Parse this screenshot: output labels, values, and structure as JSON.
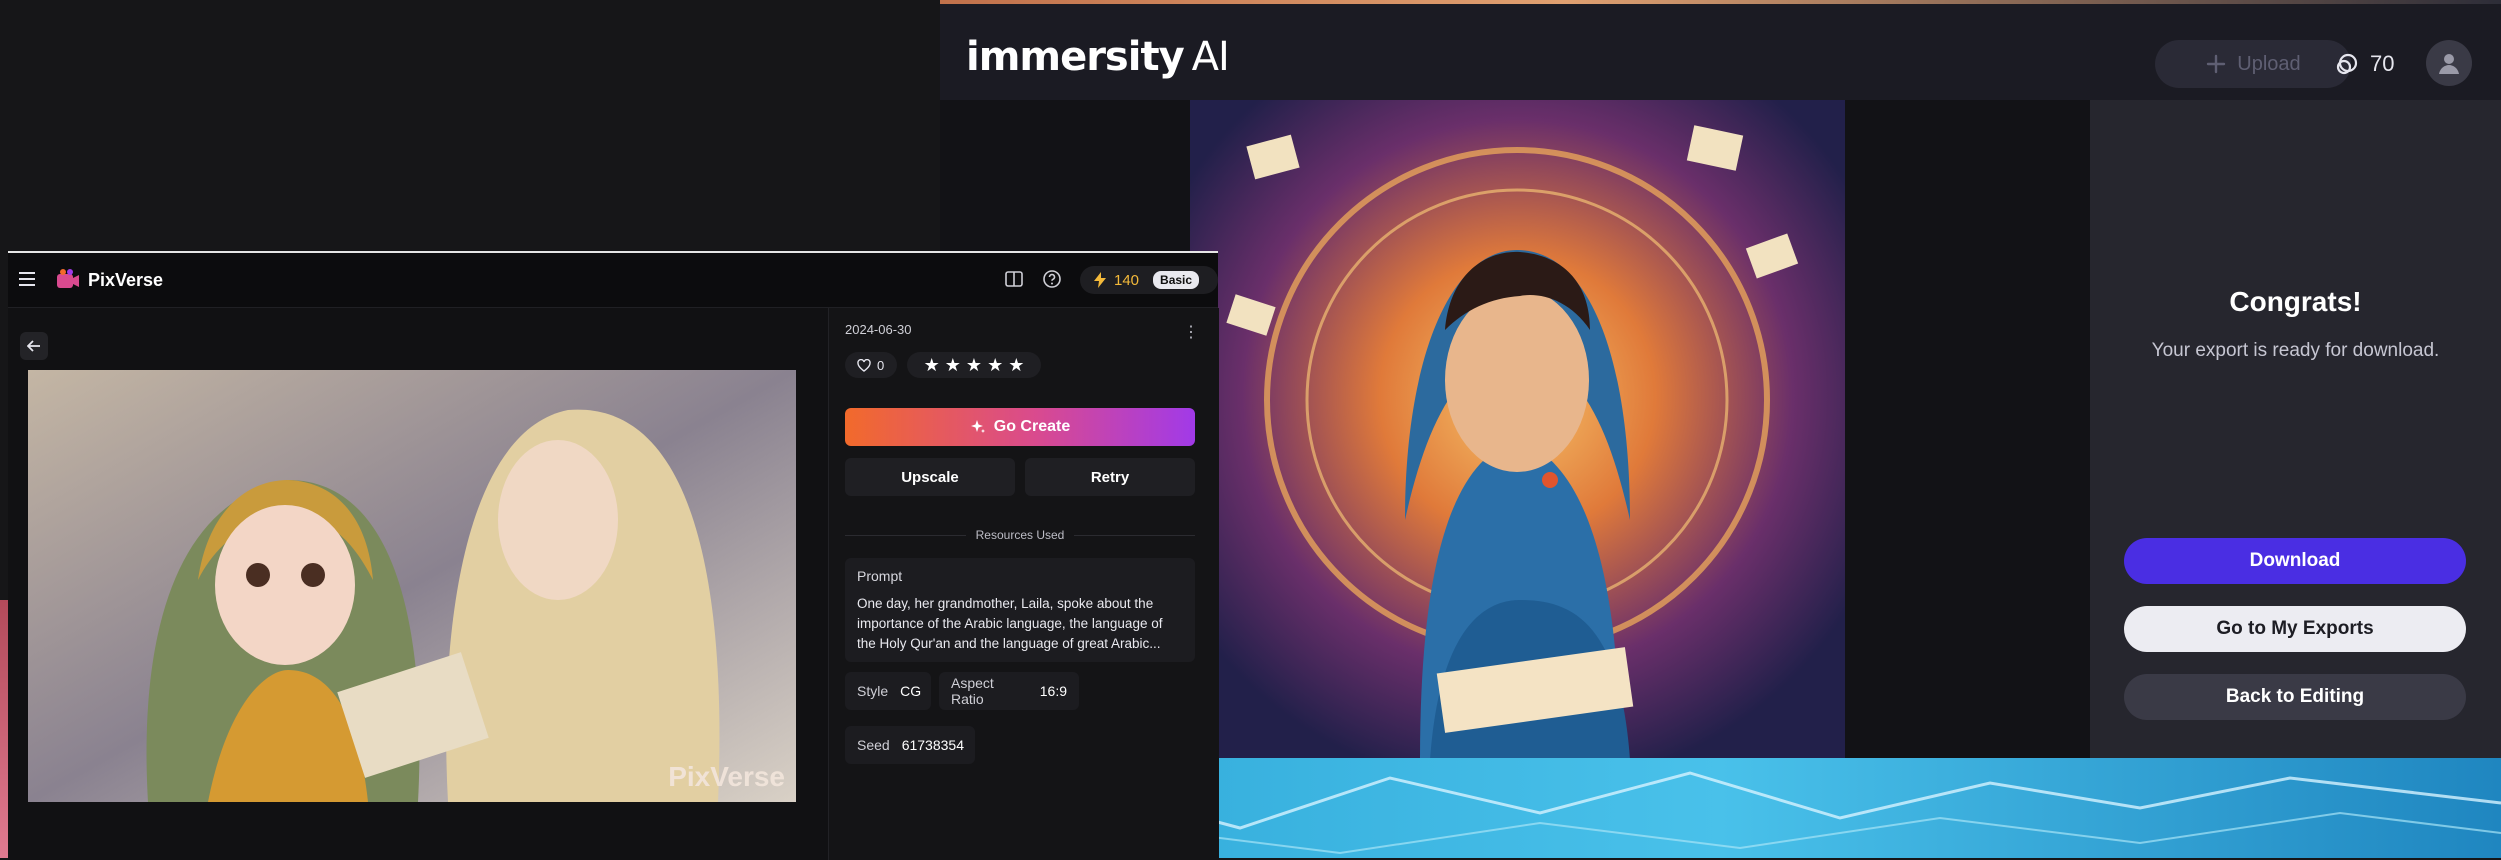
{
  "immersity": {
    "logo_main": "immersity",
    "logo_ai": "AI",
    "upload_label": "Upload",
    "credits": "70",
    "congrats_title": "Congrats!",
    "ready_text": "Your export is ready for download.",
    "download_label": "Download",
    "exports_label": "Go to My Exports",
    "back_label": "Back to Editing"
  },
  "pixverse": {
    "app_name": "PixVerse",
    "credits": "140",
    "plan": "Basic",
    "date": "2024-06-30",
    "likes": "0",
    "rating": 5,
    "go_create_label": "Go Create",
    "upscale_label": "Upscale",
    "retry_label": "Retry",
    "resources_label": "Resources Used",
    "prompt_label": "Prompt",
    "prompt_text": "One day, her grandmother, Laila, spoke about the importance of the Arabic language, the language of the Holy Qur'an and the language of great Arabic...",
    "style_label": "Style",
    "style_value": "CG",
    "aspect_label": "Aspect Ratio",
    "aspect_value": "16:9",
    "seed_label": "Seed",
    "seed_value": "61738354",
    "watermark": "PixVerse"
  },
  "colors": {
    "immersity_accent": "#4a2ee3",
    "pixverse_gradient_start": "#f26a2b",
    "pixverse_gradient_end": "#a13ae8",
    "credit_gold": "#f3b93a"
  }
}
